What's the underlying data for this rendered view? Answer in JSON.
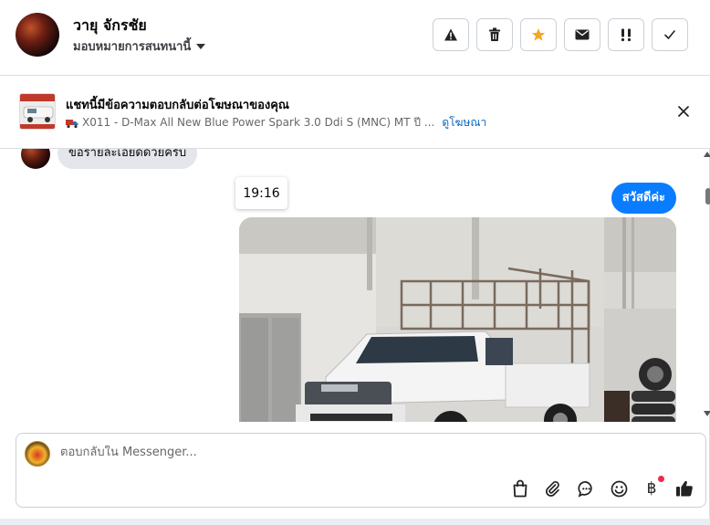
{
  "header": {
    "contact_name": "วายุ จักรชัย",
    "assign_label": "มอบหมายการสนทนานี้",
    "actions": [
      {
        "name": "report-spam",
        "icon": "warning-icon"
      },
      {
        "name": "delete",
        "icon": "trash-icon"
      },
      {
        "name": "star",
        "icon": "star-icon",
        "color": "#f5a623"
      },
      {
        "name": "mark-unread",
        "icon": "envelope-icon"
      },
      {
        "name": "follow-up",
        "icon": "exclamation-icon"
      },
      {
        "name": "done",
        "icon": "check-icon"
      }
    ]
  },
  "ad_banner": {
    "title": "แชทนี้มีข้อความตอบกลับต่อโฆษณาของคุณ",
    "ad_text": "X011 - D-Max All New Blue Power Spark 3.0 Ddi S (MNC) MT ปี ...",
    "ad_icon": "truck-icon",
    "link_label": "ดูโฆษณา"
  },
  "messages": {
    "incoming_text": "ขอรายละเอียดด้วยครับ",
    "timestamp": "19:16",
    "outgoing_text": "สวัสดีค่ะ",
    "photo_description_icon": "truck-photo"
  },
  "composer": {
    "placeholder": "ตอบกลับใน Messenger...",
    "tools": [
      {
        "name": "shop-button",
        "icon": "shopping-bag-icon"
      },
      {
        "name": "attach-button",
        "icon": "paperclip-icon"
      },
      {
        "name": "saved-replies-button",
        "icon": "chat-bubble-icon"
      },
      {
        "name": "emoji-button",
        "icon": "smiley-icon"
      },
      {
        "name": "payment-button",
        "icon": "baht-icon",
        "label": "฿"
      },
      {
        "name": "like-button",
        "icon": "thumbs-up-icon"
      }
    ]
  },
  "colors": {
    "accent": "#0a7cff",
    "star": "#f5a623",
    "notification": "#f02849",
    "link": "#0a66c2"
  }
}
